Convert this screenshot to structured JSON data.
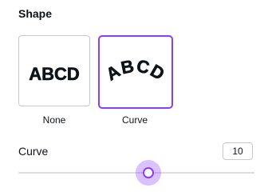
{
  "shape_section": {
    "title": "Shape",
    "options": [
      {
        "label": "None",
        "preview_text": "ABCD",
        "selected": false
      },
      {
        "label": "Curve",
        "preview_text": "ABCD",
        "selected": true
      }
    ]
  },
  "curve_control": {
    "label": "Curve",
    "value": "10",
    "slider_min": -100,
    "slider_max": 100,
    "slider_value": 10
  },
  "colors": {
    "accent": "#8b3dff",
    "text": "#0e1318",
    "border": "#c8c9cc",
    "track": "#dcdde0"
  }
}
